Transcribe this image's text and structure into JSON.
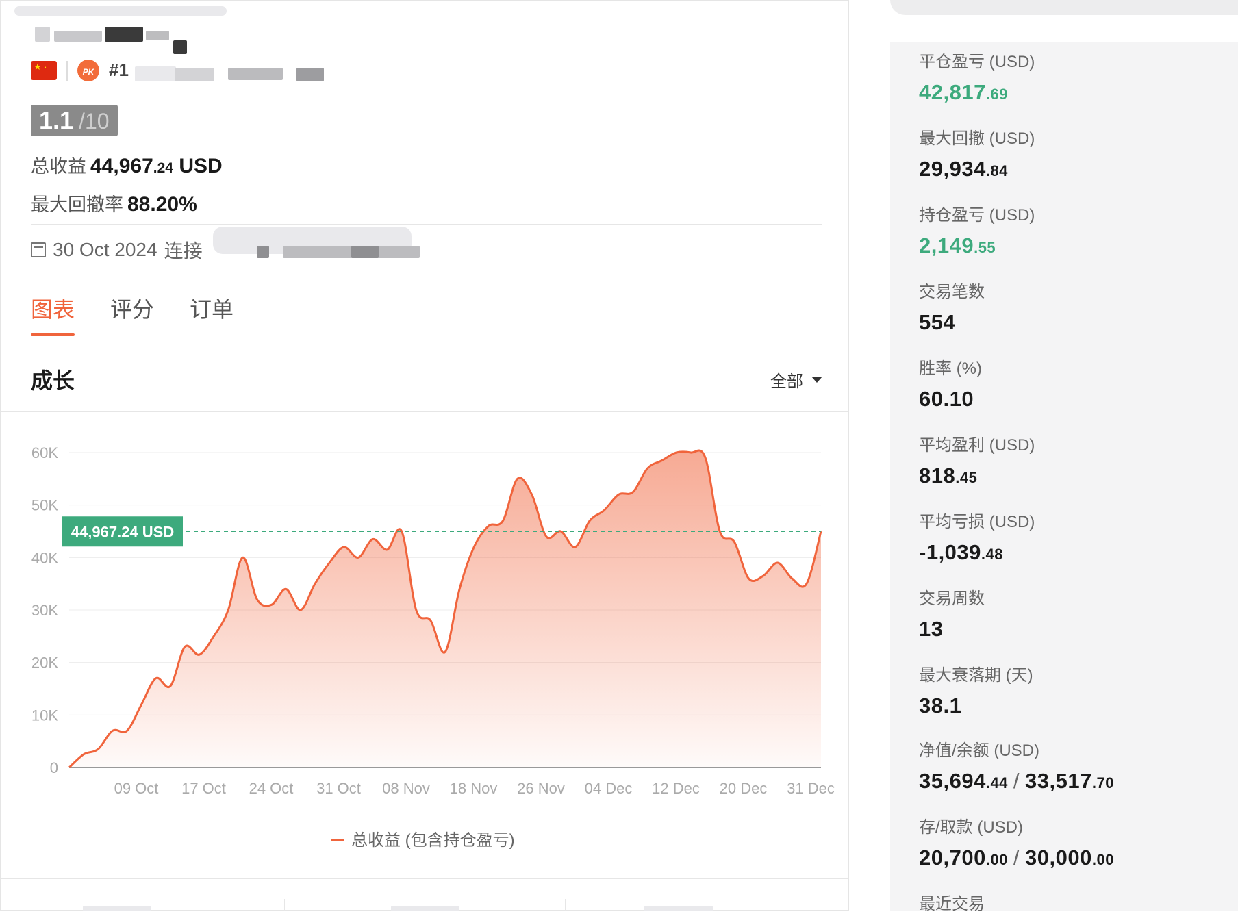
{
  "profile": {
    "rank_prefix": "#1",
    "flag_icon": "china-flag-icon",
    "badge_label": "PK"
  },
  "score": {
    "value": "1.1",
    "max": "/10"
  },
  "summary": {
    "total_label": "总收益",
    "total_value": "44,967",
    "total_decimals": ".24",
    "total_unit": "USD",
    "drawdown_label": "最大回撤率",
    "drawdown_value": "88.20%"
  },
  "connected": {
    "date": "30 Oct 2024",
    "text": "连接"
  },
  "tabs": [
    {
      "label": "图表",
      "active": true
    },
    {
      "label": "评分",
      "active": false
    },
    {
      "label": "订单",
      "active": false
    }
  ],
  "growth": {
    "title": "成长",
    "range_label": "全部"
  },
  "chart_data": {
    "type": "area",
    "x": [
      "09 Oct",
      "17 Oct",
      "24 Oct",
      "31 Oct",
      "08 Nov",
      "18 Nov",
      "26 Nov",
      "04 Dec",
      "12 Dec",
      "20 Dec",
      "31 Dec"
    ],
    "series": [
      {
        "name": "总收益 (包含持仓盈亏)",
        "color": "#f0643c",
        "values": [
          0,
          2500,
          3500,
          7000,
          7000,
          12000,
          17000,
          15500,
          23000,
          21500,
          25000,
          30000,
          40000,
          32000,
          31000,
          34000,
          30000,
          35000,
          39000,
          42000,
          40000,
          43500,
          41500,
          45000,
          30000,
          28000,
          22000,
          34000,
          42000,
          46000,
          47000,
          55000,
          52000,
          44000,
          45000,
          42000,
          47000,
          49000,
          52000,
          52500,
          57000,
          58500,
          60000,
          60000,
          59000,
          45000,
          43000,
          36000,
          36500,
          39000,
          36000,
          35000,
          45000
        ]
      }
    ],
    "yticks": [
      "0",
      "10K",
      "20K",
      "30K",
      "40K",
      "50K",
      "60K"
    ],
    "ylim": [
      0,
      60000
    ],
    "current_value": 44967.24,
    "current_label": "44,967.24 USD",
    "legend": "总收益 (包含持仓盈亏)",
    "reference_line_color": "#3daa7d"
  },
  "metrics": [
    {
      "label": "平仓盈亏 (USD)",
      "value": "42,817",
      "dec": ".69",
      "green": true
    },
    {
      "label": "最大回撤 (USD)",
      "value": "29,934",
      "dec": ".84",
      "green": false
    },
    {
      "label": "持仓盈亏 (USD)",
      "value": "2,149",
      "dec": ".55",
      "green": true
    },
    {
      "label": "交易笔数",
      "value": "554",
      "dec": "",
      "green": false
    },
    {
      "label": "胜率 (%)",
      "value": "60.10",
      "dec": "",
      "green": false
    },
    {
      "label": "平均盈利 (USD)",
      "value": "818",
      "dec": ".45",
      "green": false
    },
    {
      "label": "平均亏损 (USD)",
      "value": "-1,039",
      "dec": ".48",
      "green": false
    },
    {
      "label": "交易周数",
      "value": "13",
      "dec": "",
      "green": false
    },
    {
      "label": "最大衰落期 (天)",
      "value": "38.1",
      "dec": "",
      "green": false
    }
  ],
  "equity_balance": {
    "label": "净值/余额 (USD)",
    "equity": "35,694",
    "equity_dec": ".44",
    "separator": "/",
    "balance": "33,517",
    "balance_dec": ".70"
  },
  "deposits": {
    "label": "存/取款 (USD)",
    "deposit": "20,700",
    "deposit_dec": ".00",
    "separator": "/",
    "withdraw": "30,000",
    "withdraw_dec": ".00"
  },
  "recent_trades_label": "最近交易"
}
